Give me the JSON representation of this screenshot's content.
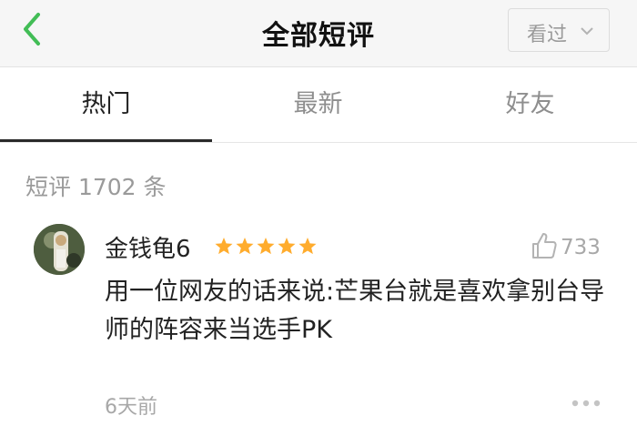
{
  "header": {
    "title": "全部短评",
    "back_icon": "chevron-left-icon",
    "filter_label": "看过",
    "accent_color": "#42bd56"
  },
  "tabs": [
    {
      "label": "热门",
      "active": true
    },
    {
      "label": "最新",
      "active": false
    },
    {
      "label": "好友",
      "active": false
    }
  ],
  "review_count_label": "短评 1702 条",
  "review": {
    "username": "金钱龟6",
    "rating_stars": 5,
    "star_color": "#ffac2d",
    "likes": "733",
    "text": "用一位网友的话来说:芒果台就是喜欢拿别台导师的阵容来当选手PK",
    "time": "6天前"
  }
}
